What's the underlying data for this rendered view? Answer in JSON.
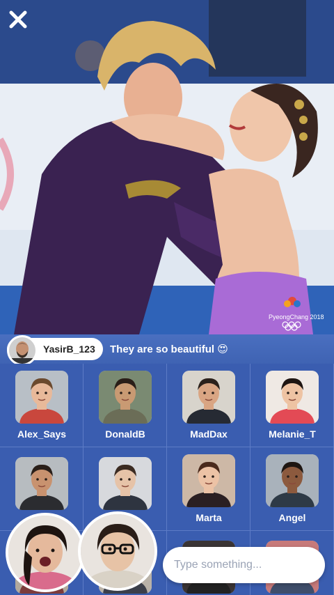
{
  "comment": {
    "username": "YasirB_123",
    "text": "They are so beautiful 😍"
  },
  "overlay": {
    "logo_text": "PyeongChang 2018"
  },
  "participants": [
    {
      "name": "Alex_Says",
      "skin": "#e8b99a",
      "hair": "#6b4a2e",
      "shirt": "#c9473d",
      "bg": "#b8bfc6"
    },
    {
      "name": "DonaldB",
      "skin": "#c99a73",
      "hair": "#2a1e18",
      "shirt": "#6b6d57",
      "bg": "#7a8a72"
    },
    {
      "name": "MadDax",
      "skin": "#d9a583",
      "hair": "#2b211c",
      "shirt": "#262a33",
      "bg": "#d8d4cc"
    },
    {
      "name": "Melanie_T",
      "skin": "#eec3a3",
      "hair": "#1e1512",
      "shirt": "#e34a55",
      "bg": "#efe9e4"
    },
    {
      "name": "",
      "skin": "#c8926f",
      "hair": "#2a1f19",
      "shirt": "#2b2c30",
      "bg": "#b7bcc0"
    },
    {
      "name": "",
      "skin": "#e6c3a8",
      "hair": "#3b2b22",
      "shirt": "#2e3440",
      "bg": "#d7d9dd"
    },
    {
      "name": "Marta",
      "skin": "#ecc2a5",
      "hair": "#4a2a1c",
      "shirt": "#2a1f22",
      "bg": "#cdb8a6"
    },
    {
      "name": "Angel",
      "skin": "#8c5a3e",
      "hair": "#1e1612",
      "shirt": "#2e3a46",
      "bg": "#a9b2bb"
    },
    {
      "name": "",
      "skin": "#d7a886",
      "hair": "#2c2220",
      "shirt": "#7c3b3b",
      "bg": "#b2a99c"
    },
    {
      "name": "",
      "skin": "#d6a98b",
      "hair": "#2a201c",
      "shirt": "#3b3f4a",
      "bg": "#b9b2a8"
    },
    {
      "name": "",
      "skin": "#caa08a",
      "hair": "#1b1411",
      "shirt": "#222",
      "bg": "#3a3434"
    },
    {
      "name": "",
      "skin": "#d8b092",
      "hair": "#3d2a20",
      "shirt": "#3f4e6b",
      "bg": "#c77a7a"
    }
  ],
  "self_cams": [
    {
      "id": "girl",
      "skin": "#e5b99c",
      "hair": "#1e1410",
      "shirt": "#d96b8c"
    },
    {
      "id": "guy",
      "skin": "#e7c3a6",
      "hair": "#2a1d17",
      "shirt": "#d9d2c6"
    }
  ],
  "input": {
    "placeholder": "Type something..."
  },
  "colors": {
    "panel": "#3a5db0",
    "comment_bar": "#4468b9",
    "grid_line": "#5d7cc6"
  }
}
